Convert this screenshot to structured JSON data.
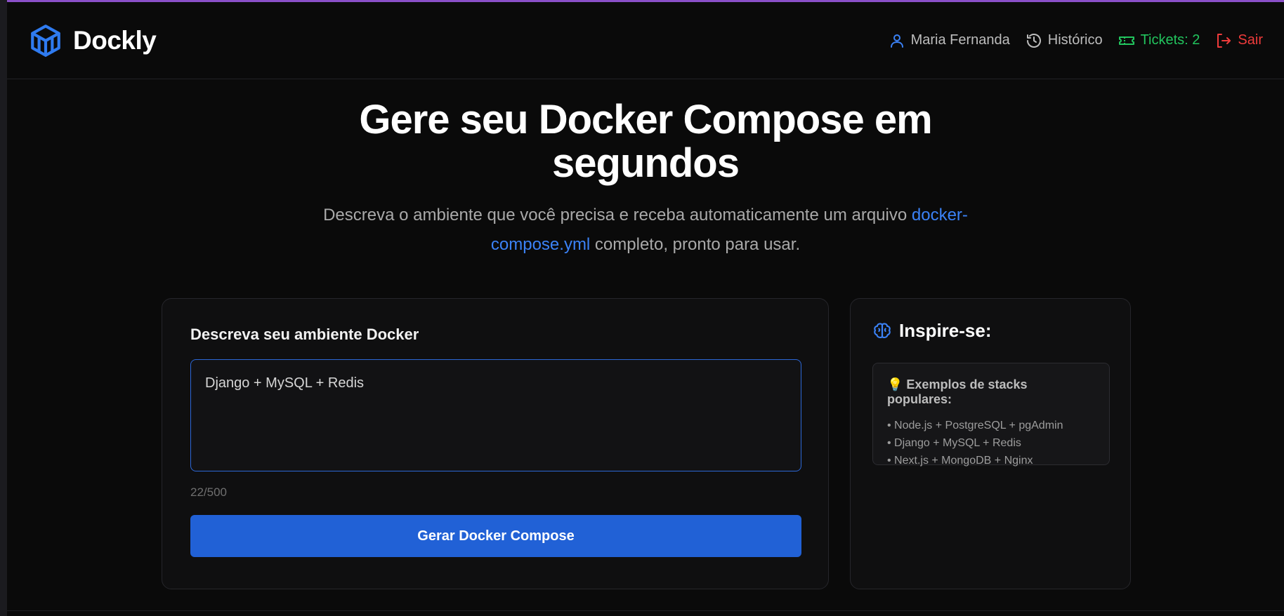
{
  "brand": {
    "name": "Dockly"
  },
  "nav": {
    "user": "Maria Fernanda",
    "history": "Histórico",
    "tickets": "Tickets: 2",
    "logout": "Sair"
  },
  "hero": {
    "title": "Gere seu Docker Compose em segundos",
    "subtitle_before": "Descreva o ambiente que você precisa e receba automaticamente um arquivo ",
    "subtitle_link": "docker-compose.yml",
    "subtitle_after": " completo, pronto para usar."
  },
  "form": {
    "label": "Descreva seu ambiente Docker",
    "value": "Django + MySQL + Redis",
    "counter": "22/500",
    "submit_label": "Gerar Docker Compose"
  },
  "inspire": {
    "title": "Inspire-se:",
    "examples_title": "💡 Exemplos de stacks populares:",
    "examples": [
      "• Node.js + PostgreSQL + pgAdmin",
      "• Django + MySQL + Redis",
      "• Next.js + MongoDB + Nginx"
    ]
  },
  "colors": {
    "accent": "#2161d6",
    "link": "#3b82f6",
    "tickets": "#22c55e",
    "logout": "#ef3b3b",
    "top_bar": "#8a4fc8"
  }
}
